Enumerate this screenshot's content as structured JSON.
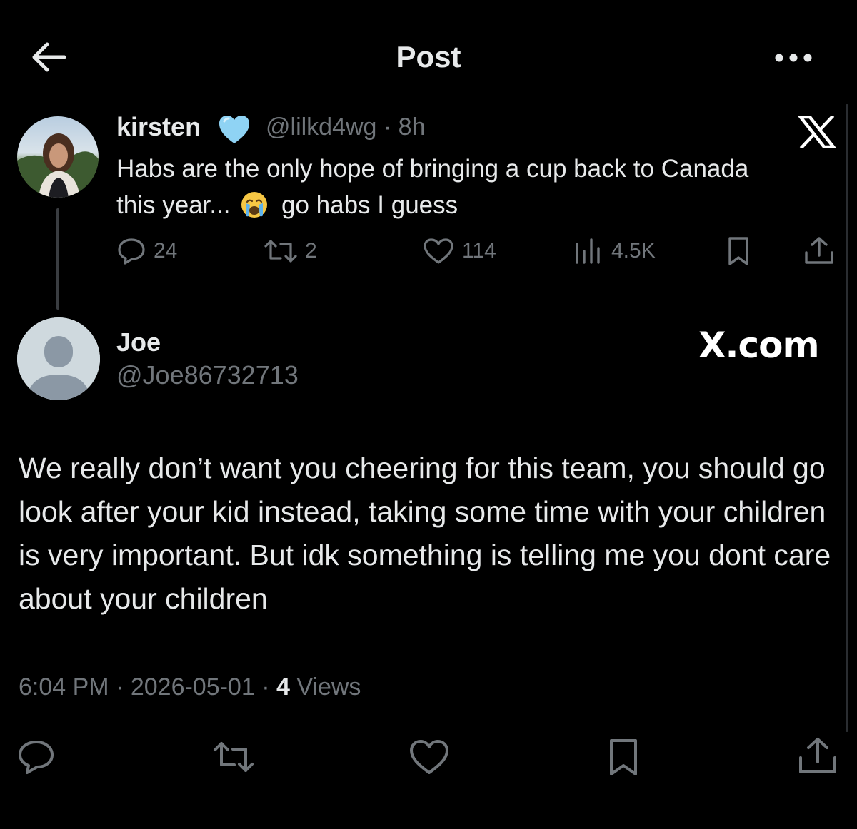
{
  "header": {
    "title": "Post",
    "back_icon": "arrow-left-icon",
    "more_icon": "more-horizontal-icon"
  },
  "parent_post": {
    "name": "kirsten",
    "verified_heart_color": "#8fd3f4",
    "handle_time": "@lilkd4wg · 8h",
    "text_line1": "Habs are the only hope of bringing a cup back to Canada",
    "text_line2_before": "this year...",
    "emoji": "loudly-crying-face",
    "text_line2_after": "go habs I guess",
    "actions": {
      "replies": "24",
      "reposts": "2",
      "likes": "114",
      "views": "4.5K"
    }
  },
  "watermark": {
    "x_logo": "x-logo-icon",
    "domain": "X.com"
  },
  "reply": {
    "name": "Joe",
    "handle": "@Joe86732713",
    "text": "We really don’t want you cheering for this team, you should go look after your kid instead, taking some time with your children is very important. But idk something is telling me you dont care about your children",
    "time_date": "6:04 PM · 2026-05-01 · ",
    "views_count": "4",
    "views_label": " Views"
  },
  "colors": {
    "background": "#000000",
    "text": "#e7e9ea",
    "muted": "#71767b"
  }
}
